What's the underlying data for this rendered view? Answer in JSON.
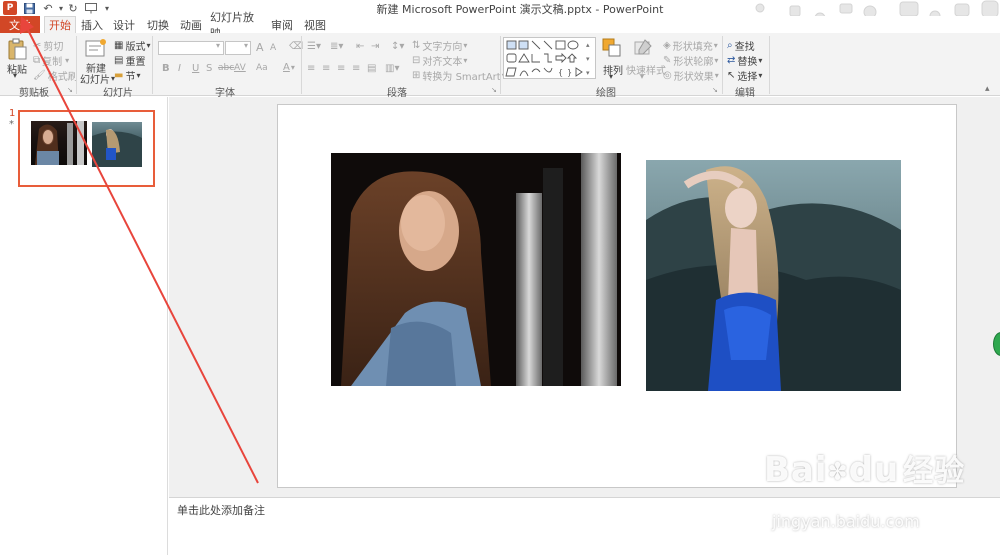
{
  "window": {
    "title": "新建 Microsoft PowerPoint 演示文稿.pptx - PowerPoint",
    "logo_letter": "P"
  },
  "tabs": {
    "file": "文件",
    "items": [
      "开始",
      "插入",
      "设计",
      "切换",
      "动画",
      "幻灯片放映",
      "审阅",
      "视图"
    ]
  },
  "ribbon": {
    "clipboard": {
      "group": "剪贴板",
      "paste": "粘贴",
      "cut": "剪切",
      "copy": "复制",
      "format_painter": "格式刷"
    },
    "slides": {
      "group": "幻灯片",
      "new_slide_line1": "新建",
      "new_slide_line2": "幻灯片",
      "layout": "版式",
      "reset": "重置",
      "section": "节"
    },
    "font": {
      "group": "字体",
      "font_name": "",
      "font_size": "",
      "bold": "B",
      "italic": "I",
      "underline": "U",
      "shadow": "S",
      "strike": "abc",
      "spacing": "AV",
      "case": "Aa",
      "color": "A",
      "grow": "A",
      "shrink": "A"
    },
    "paragraph": {
      "group": "段落",
      "text_direction": "文字方向",
      "align_text": "对齐文本",
      "smartart": "转换为 SmartArt"
    },
    "drawing": {
      "group": "绘图",
      "arrange": "排列",
      "quick_styles": "快速样式",
      "shape_fill": "形状填充",
      "shape_outline": "形状轮廓",
      "shape_effects": "形状效果"
    },
    "editing": {
      "group": "编辑",
      "find": "查找",
      "replace": "替换",
      "select": "选择"
    }
  },
  "thumbnails": {
    "slide_number": "1",
    "star": "*"
  },
  "notes": {
    "placeholder": "单击此处添加备注"
  },
  "watermark": {
    "brand": "Bai",
    "brand2": "du",
    "cn": "经验",
    "url": "jingyan.baidu.com"
  },
  "colors": {
    "accent": "#d24726",
    "annotation": "#e8453c"
  }
}
